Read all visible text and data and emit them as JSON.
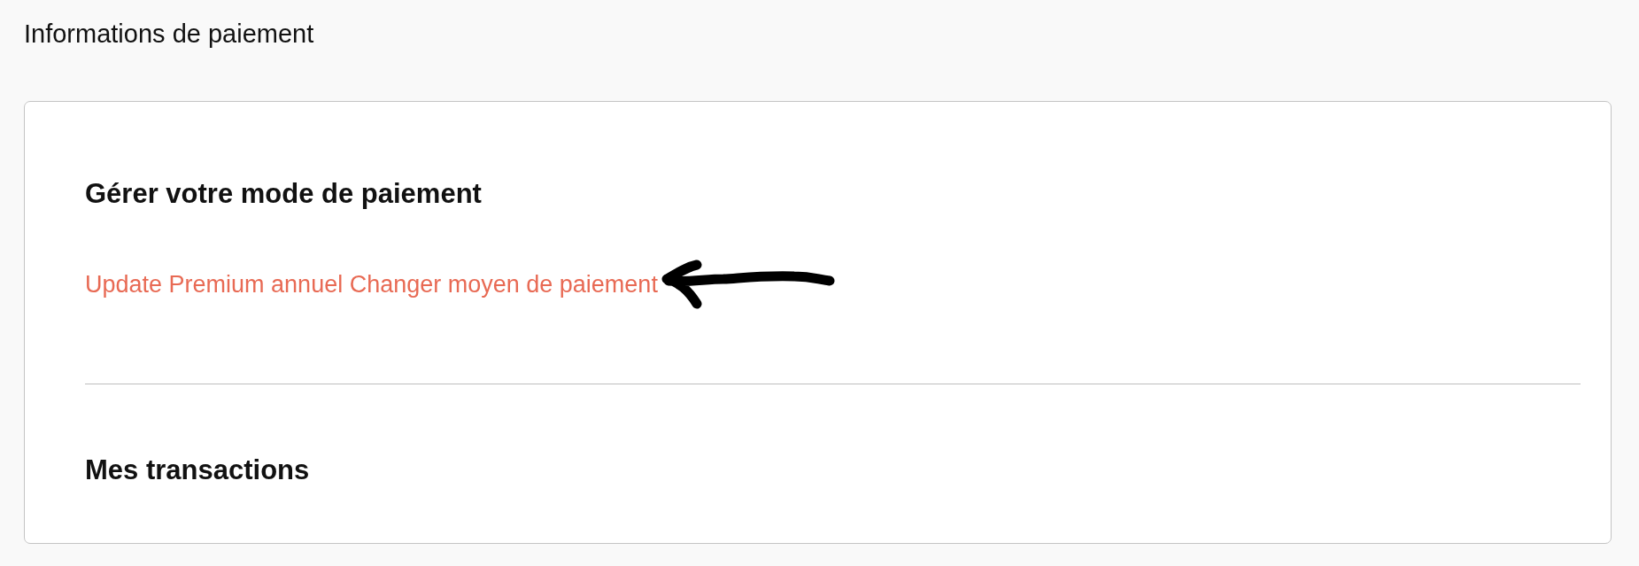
{
  "page": {
    "title": "Informations de paiement"
  },
  "card": {
    "sections": [
      {
        "heading": "Gérer votre mode de paiement",
        "link": "Update Premium annuel Changer moyen de paiement"
      },
      {
        "heading": "Mes transactions"
      }
    ]
  }
}
